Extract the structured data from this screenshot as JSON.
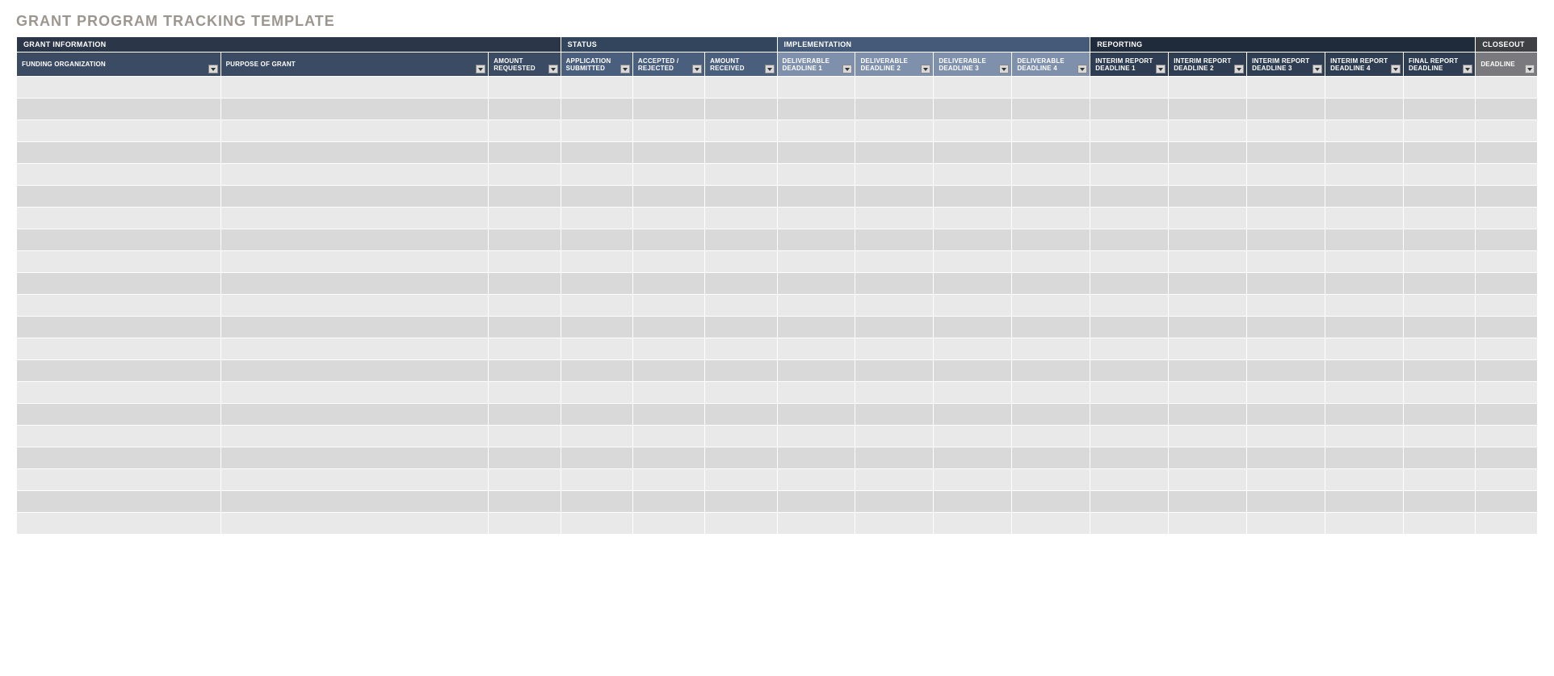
{
  "title": "GRANT PROGRAM TRACKING TEMPLATE",
  "sections": {
    "grant": "GRANT INFORMATION",
    "status": "STATUS",
    "impl": "IMPLEMENTATION",
    "report": "REPORTING",
    "closeout": "CLOSEOUT"
  },
  "columns": {
    "funding_org": "FUNDING ORGANIZATION",
    "purpose": "PURPOSE OF GRANT",
    "amount_requested": "AMOUNT REQUESTED",
    "app_submitted": "APPLICATION SUBMITTED",
    "accepted_rejected": "ACCEPTED / REJECTED",
    "amount_received": "AMOUNT RECEIVED",
    "deliv1": "DELIVERABLE DEADLINE 1",
    "deliv2": "DELIVERABLE DEADLINE 2",
    "deliv3": "DELIVERABLE DEADLINE 3",
    "deliv4": "DELIVERABLE DEADLINE 4",
    "interim1": "INTERIM REPORT DEADLINE 1",
    "interim2": "INTERIM REPORT DEADLINE 2",
    "interim3": "INTERIM REPORT DEADLINE 3",
    "interim4": "INTERIM REPORT DEADLINE 4",
    "final_report": "FINAL REPORT DEADLINE",
    "deadline": "DEADLINE"
  },
  "row_count": 21
}
